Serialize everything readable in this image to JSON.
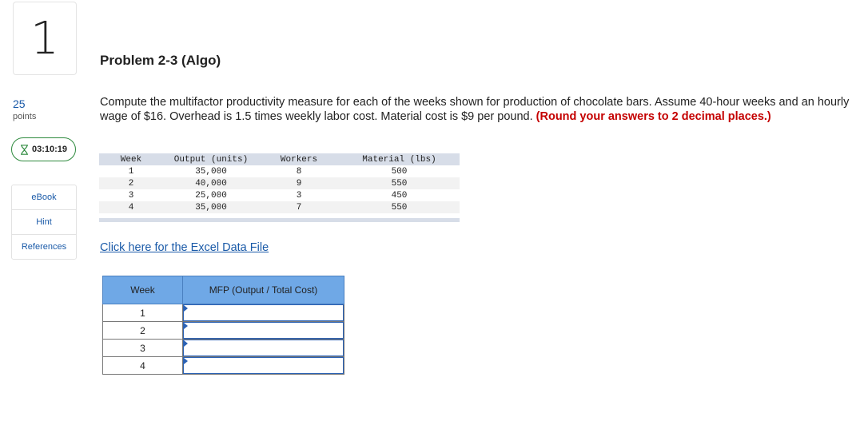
{
  "question": {
    "number": "1",
    "points_value": "25",
    "points_label": "points",
    "timer": "03:10:19",
    "title": "Problem 2-3 (Algo)",
    "text": "Compute the multifactor productivity measure for each of the weeks shown for production of chocolate bars. Assume 40-hour weeks and an hourly wage of $16. Overhead is 1.5 times weekly labor cost. Material cost is $9 per pound.",
    "emphasis": "(Round your answers to 2 decimal places.)"
  },
  "tools": [
    "eBook",
    "Hint",
    "References"
  ],
  "data_table": {
    "headers": [
      "Week",
      "Output (units)",
      "Workers",
      "Material (lbs)"
    ],
    "rows": [
      [
        "1",
        "35,000",
        "8",
        "500"
      ],
      [
        "2",
        "40,000",
        "9",
        "550"
      ],
      [
        "3",
        "25,000",
        "3",
        "450"
      ],
      [
        "4",
        "35,000",
        "7",
        "550"
      ]
    ]
  },
  "excel_link": "Click here for the Excel Data File",
  "answer_table": {
    "headers": [
      "Week",
      "MFP (Output / Total Cost)"
    ],
    "weeks": [
      "1",
      "2",
      "3",
      "4"
    ],
    "values": [
      "",
      "",
      "",
      ""
    ]
  },
  "colors": {
    "link": "#1a5aa8",
    "emphasis": "#c40000",
    "timer_border": "#2e8a3e",
    "answer_header": "#6fa8e6"
  }
}
